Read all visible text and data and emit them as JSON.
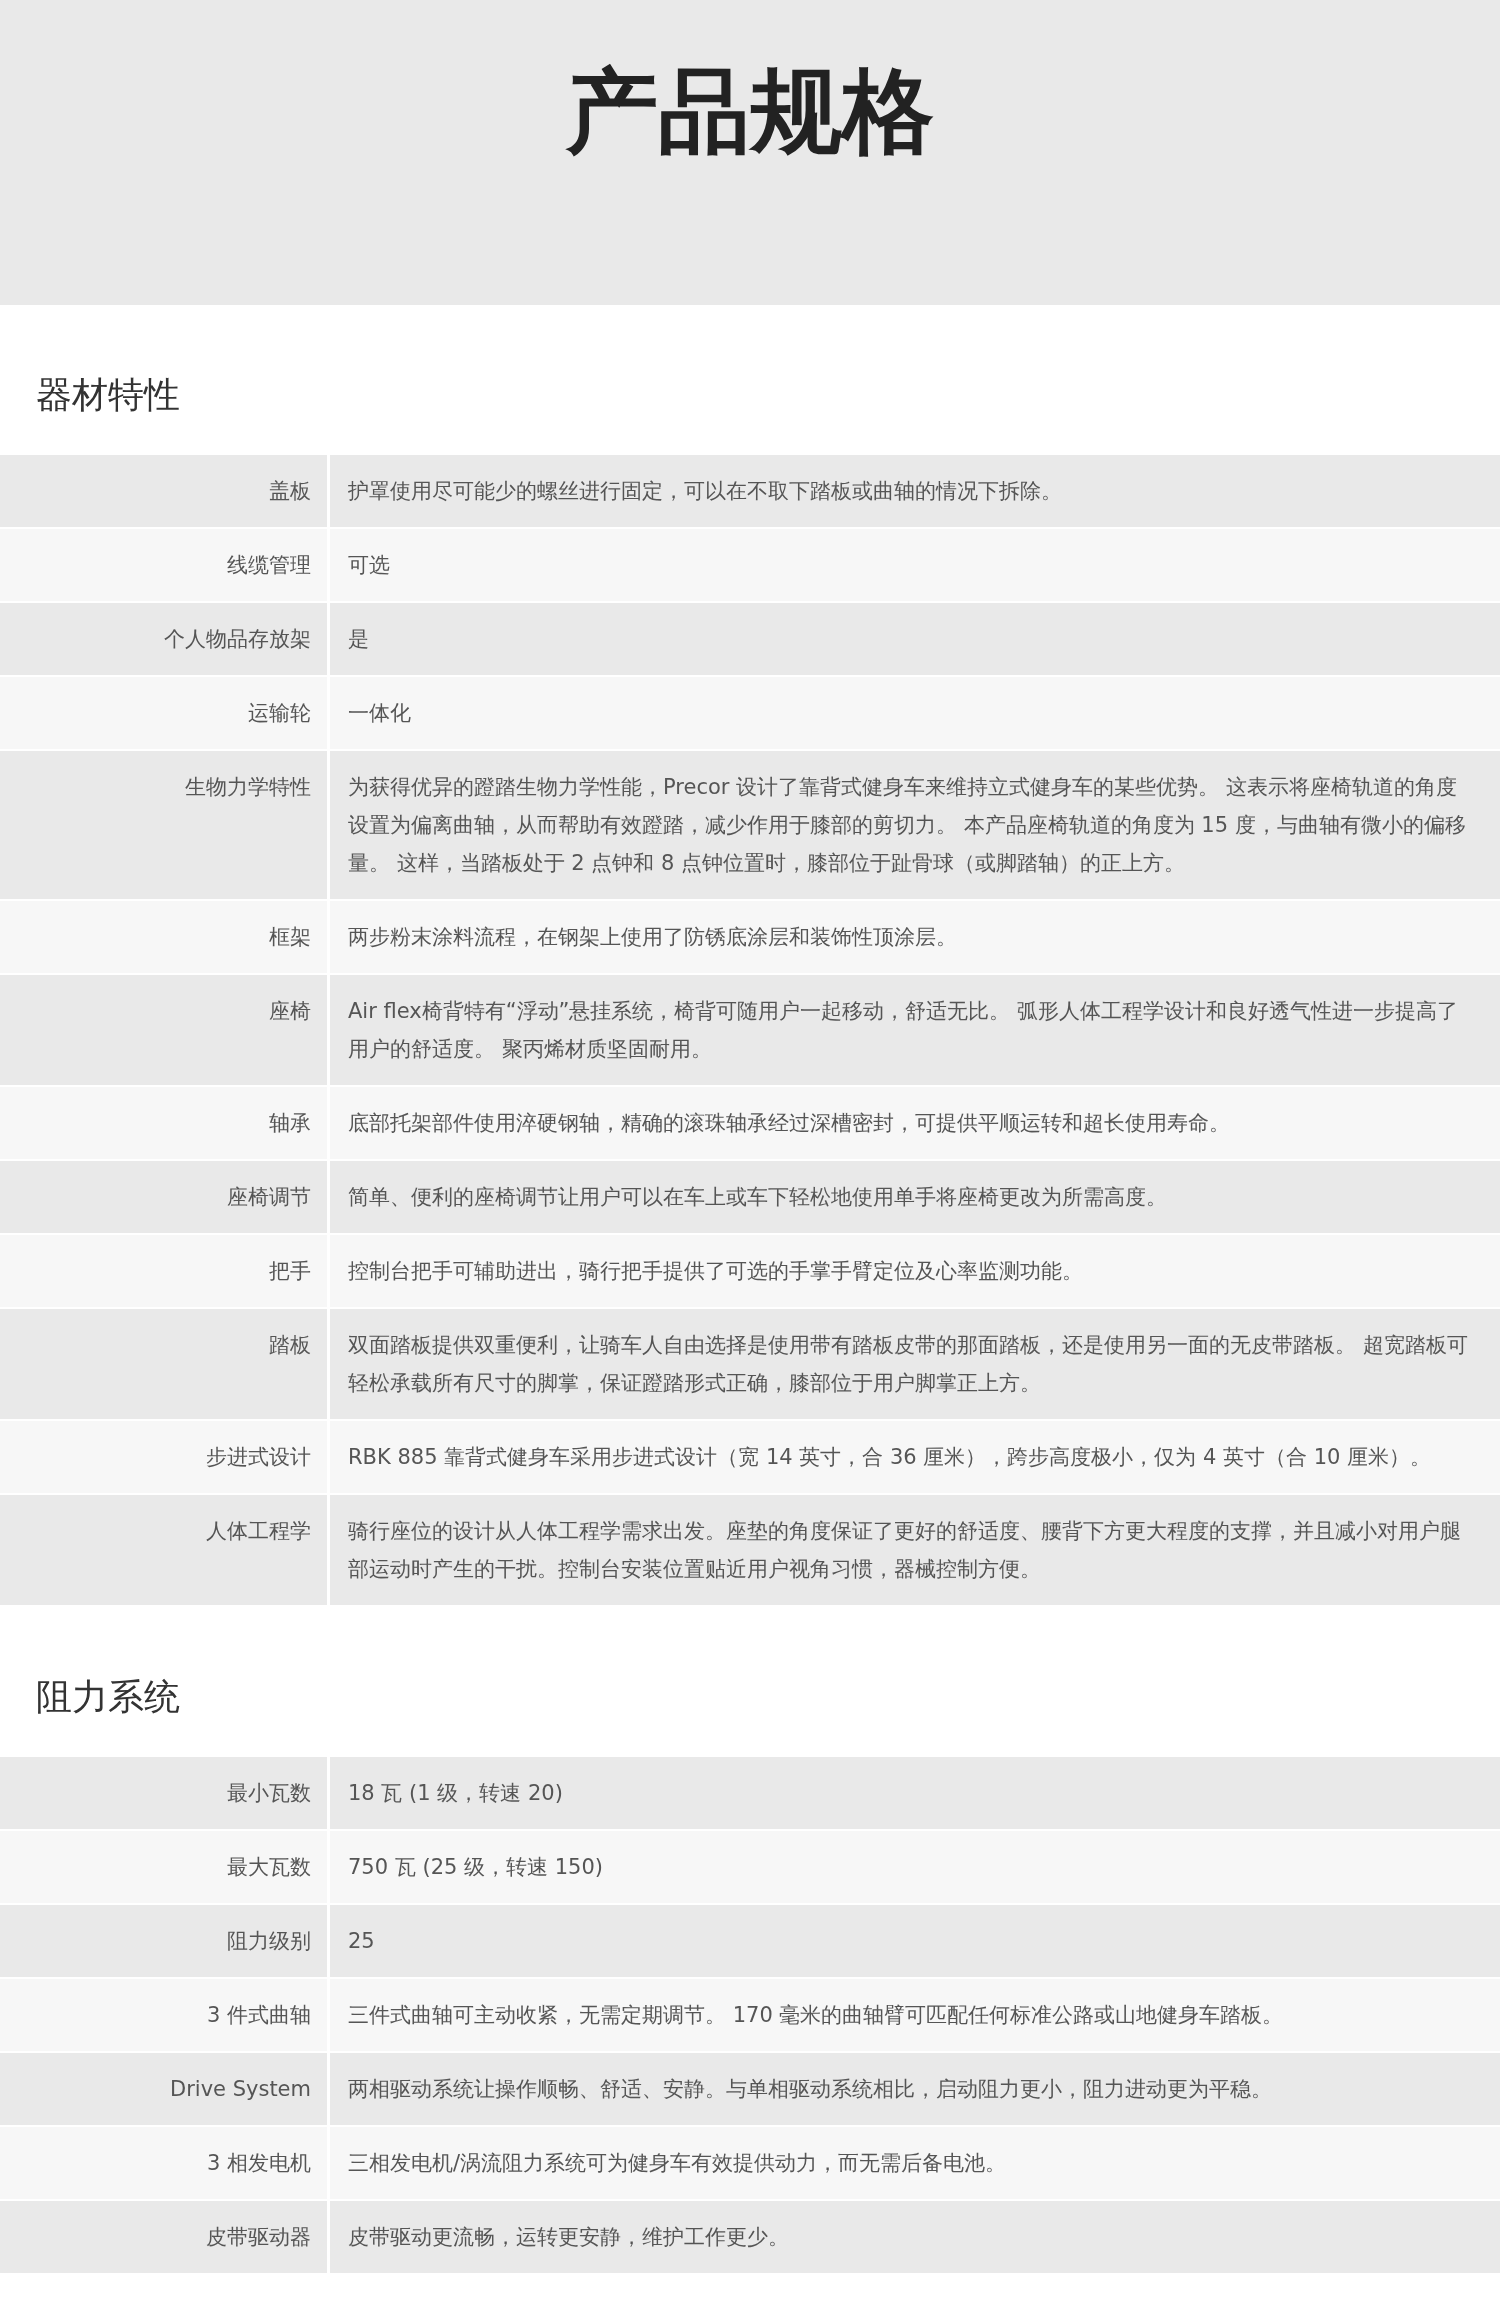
{
  "title": "产品规格",
  "sections": [
    {
      "heading": "器材特性",
      "rows": [
        {
          "label": "盖板",
          "value": "护罩使用尽可能少的螺丝进行固定，可以在不取下踏板或曲轴的情况下拆除。"
        },
        {
          "label": "线缆管理",
          "value": "可选"
        },
        {
          "label": "个人物品存放架",
          "value": "是"
        },
        {
          "label": "运输轮",
          "value": "一体化"
        },
        {
          "label": "生物力学特性",
          "value": "为获得优异的蹬踏生物力学性能，Precor 设计了靠背式健身车来维持立式健身车的某些优势。 这表示将座椅轨道的角度设置为偏离曲轴，从而帮助有效蹬踏，减少作用于膝部的剪切力。 本产品座椅轨道的角度为 15 度，与曲轴有微小的偏移量。 这样，当踏板处于 2 点钟和 8 点钟位置时，膝部位于趾骨球（或脚踏轴）的正上方。"
        },
        {
          "label": "框架",
          "value": "两步粉末涂料流程，在钢架上使用了防锈底涂层和装饰性顶涂层。"
        },
        {
          "label": "座椅",
          "value": "Air flex椅背特有“浮动”悬挂系统，椅背可随用户一起移动，舒适无比。 弧形人体工程学设计和良好透气性进一步提高了用户的舒适度。 聚丙烯材质坚固耐用。"
        },
        {
          "label": "轴承",
          "value": "底部托架部件使用淬硬钢轴，精确的滚珠轴承经过深槽密封，可提供平顺运转和超长使用寿命。"
        },
        {
          "label": "座椅调节",
          "value": "简单、便利的座椅调节让用户可以在车上或车下轻松地使用单手将座椅更改为所需高度。"
        },
        {
          "label": "把手",
          "value": "控制台把手可辅助进出，骑行把手提供了可选的手掌手臂定位及心率监测功能。"
        },
        {
          "label": "踏板",
          "value": "双面踏板提供双重便利，让骑车人自由选择是使用带有踏板皮带的那面踏板，还是使用另一面的无皮带踏板。 超宽踏板可轻松承载所有尺寸的脚掌，保证蹬踏形式正确，膝部位于用户脚掌正上方。"
        },
        {
          "label": "步进式设计",
          "value": "RBK 885 靠背式健身车采用步进式设计（宽 14 英寸，合 36 厘米），跨步高度极小，仅为 4 英寸（合 10 厘米）。"
        },
        {
          "label": "人体工程学",
          "value": "骑行座位的设计从人体工程学需求出发。座垫的角度保证了更好的舒适度、腰背下方更大程度的支撑，并且减小对用户腿部运动时产生的干扰。控制台安装位置贴近用户视角习惯，器械控制方便。"
        }
      ]
    },
    {
      "heading": "阻力系统",
      "rows": [
        {
          "label": "最小瓦数",
          "value": "18 瓦 (1 级，转速 20)"
        },
        {
          "label": "最大瓦数",
          "value": "750 瓦 (25 级，转速 150)"
        },
        {
          "label": "阻力级别",
          "value": "25"
        },
        {
          "label": "3 件式曲轴",
          "value": "三件式曲轴可主动收紧，无需定期调节。 170 毫米的曲轴臂可匹配任何标准公路或山地健身车踏板。"
        },
        {
          "label": "Drive System",
          "value": "两相驱动系统让操作顺畅、舒适、安静。与单相驱动系统相比，启动阻力更小，阻力进动更为平稳。"
        },
        {
          "label": "3 相发电机",
          "value": "三相发电机/涡流阻力系统可为健身车有效提供动力，而无需后备电池。"
        },
        {
          "label": "皮带驱动器",
          "value": "皮带驱动更流畅，运转更安静，维护工作更少。"
        }
      ]
    }
  ]
}
